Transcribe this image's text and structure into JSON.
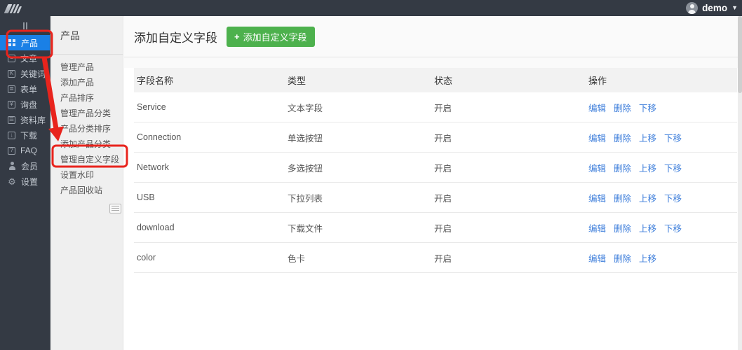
{
  "topbar": {
    "username": "demo"
  },
  "sidebar": {
    "items": [
      {
        "id": "products",
        "label": "产品",
        "icon": "grid-icon",
        "active": true
      },
      {
        "id": "articles",
        "label": "文章",
        "icon": "document-icon",
        "active": false
      },
      {
        "id": "keywords",
        "label": "关键词",
        "icon": "keyword-icon",
        "active": false
      },
      {
        "id": "forms",
        "label": "表单",
        "icon": "form-icon",
        "active": false
      },
      {
        "id": "inquiries",
        "label": "询盘",
        "icon": "inquiry-icon",
        "active": false
      },
      {
        "id": "library",
        "label": "资料库",
        "icon": "library-icon",
        "active": false
      },
      {
        "id": "downloads",
        "label": "下载",
        "icon": "download-icon",
        "active": false
      },
      {
        "id": "faq",
        "label": "FAQ",
        "icon": "question-icon",
        "active": false
      },
      {
        "id": "members",
        "label": "会员",
        "icon": "member-icon",
        "active": false
      },
      {
        "id": "settings",
        "label": "设置",
        "icon": "gear-icon",
        "active": false
      }
    ]
  },
  "submenu": {
    "title": "产品",
    "items": [
      "管理产品",
      "添加产品",
      "产品排序",
      "管理产品分类",
      "产品分类排序",
      "添加产品分类",
      "管理自定义字段",
      "设置水印",
      "产品回收站"
    ],
    "annotated_item": "管理自定义字段"
  },
  "main": {
    "page_title": "添加自定义字段",
    "add_button_label": "添加自定义字段",
    "table": {
      "headers": [
        "字段名称",
        "类型",
        "状态",
        "操作"
      ],
      "rows": [
        {
          "name": "Service",
          "type": "文本字段",
          "status": "开启",
          "actions": [
            "编辑",
            "删除",
            "下移"
          ]
        },
        {
          "name": "Connection",
          "type": "单选按钮",
          "status": "开启",
          "actions": [
            "编辑",
            "删除",
            "上移",
            "下移"
          ]
        },
        {
          "name": "Network",
          "type": "多选按钮",
          "status": "开启",
          "actions": [
            "编辑",
            "删除",
            "上移",
            "下移"
          ]
        },
        {
          "name": "USB",
          "type": "下拉列表",
          "status": "开启",
          "actions": [
            "编辑",
            "删除",
            "上移",
            "下移"
          ]
        },
        {
          "name": "download",
          "type": "下载文件",
          "status": "开启",
          "actions": [
            "编辑",
            "删除",
            "上移",
            "下移"
          ]
        },
        {
          "name": "color",
          "type": "色卡",
          "status": "开启",
          "actions": [
            "编辑",
            "删除",
            "上移"
          ]
        }
      ]
    }
  },
  "colors": {
    "topbar_dark": "#343a44",
    "accent_blue": "#1a80e6",
    "button_green": "#4db14d",
    "link_blue": "#3d7edb",
    "annotation_red": "#e8241d"
  }
}
